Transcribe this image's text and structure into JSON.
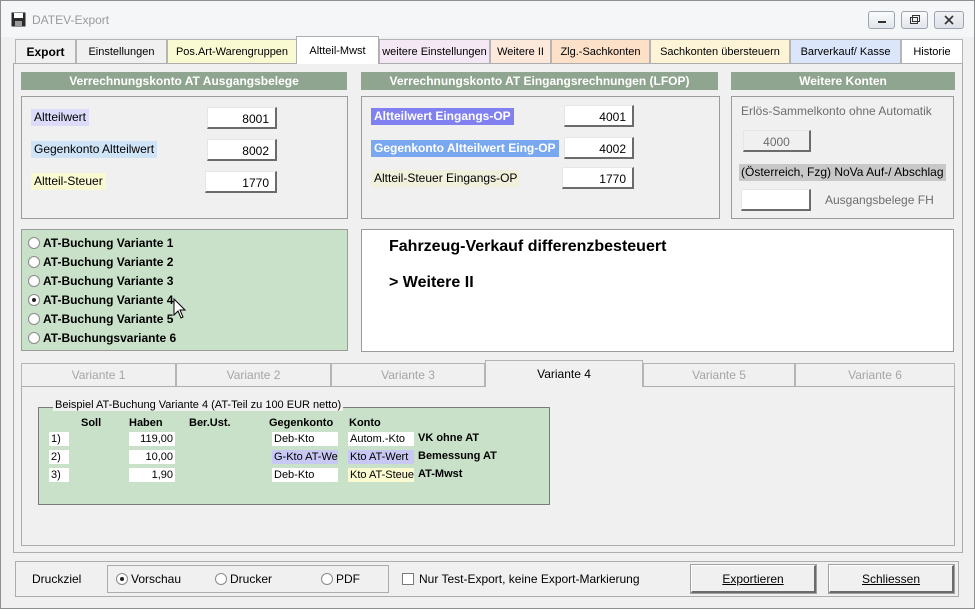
{
  "window": {
    "title": "DATEV-Export"
  },
  "tabs": [
    {
      "label": "Export"
    },
    {
      "label": "Einstellungen"
    },
    {
      "label": "Pos.Art-Warengruppen"
    },
    {
      "label": "Altteil-Mwst"
    },
    {
      "label": "weitere Einstellungen"
    },
    {
      "label": "Weitere II"
    },
    {
      "label": "Zlg.-Sachkonten"
    },
    {
      "label": "Sachkonten übersteuern"
    },
    {
      "label": "Barverkauf/ Kasse"
    },
    {
      "label": "Historie"
    }
  ],
  "tab_colors": {
    "Weitere II": "#fde8dc",
    "Zlg.-Sachkonten": "#fde0c8",
    "Sachkonten übersteuern": "#fdf4d8",
    "Barverkauf/ Kasse": "#dce6fa"
  },
  "ausgang": {
    "title": "Verrechnungskonto AT Ausgangsbelege",
    "rows": [
      {
        "label": "Altteilwert",
        "value": "8001"
      },
      {
        "label": "Gegenkonto Altteilwert",
        "value": "8002"
      },
      {
        "label": "Altteil-Steuer",
        "value": "1770"
      }
    ]
  },
  "eingang": {
    "title": "Verrechnungskonto AT Eingangsrechnungen (LFOP)",
    "rows": [
      {
        "label": "Altteilwert Eingangs-OP",
        "value": "4001"
      },
      {
        "label": "Gegenkonto Altteilwert Eing-OP",
        "value": "4002"
      },
      {
        "label": "Altteil-Steuer Eingangs-OP",
        "value": "1770"
      }
    ]
  },
  "weitere": {
    "title": "Weitere Konten",
    "erloes_label": "Erlös-Sammelkonto ohne Automatik",
    "erloes_value": "4000",
    "nova_label": "(Österreich, Fzg) NoVa Auf-/ Abschlag",
    "ausgang_fh_label": "Ausgangsbelege FH",
    "ausgang_fh_value": ""
  },
  "varianten": {
    "options": [
      "AT-Buchung Variante 1",
      "AT-Buchung Variante 2",
      "AT-Buchung Variante 3",
      "AT-Buchung Variante 4",
      "AT-Buchung Variante 5",
      "AT-Buchungsvariante 6"
    ],
    "selected_index": 3
  },
  "info": {
    "line1": "Fahrzeug-Verkauf differenzbesteuert",
    "line2": "> Weitere II"
  },
  "variant_tabs": [
    "Variante 1",
    "Variante 2",
    "Variante 3",
    "Variante 4",
    "Variante 5",
    "Variante 6"
  ],
  "example": {
    "title": "Beispiel AT-Buchung Variante 4 (AT-Teil zu 100 EUR netto)",
    "headers": {
      "soll": "Soll",
      "haben": "Haben",
      "berust": "Ber.Ust.",
      "gegenkonto": "Gegenkonto",
      "konto": "Konto"
    },
    "rows": [
      {
        "nr": "1)",
        "soll": "",
        "haben": "119,00",
        "berust": "",
        "gegenkonto": "Deb-Kto",
        "konto": "Autom.-Kto",
        "desc": "VK ohne AT"
      },
      {
        "nr": "2)",
        "soll": "",
        "haben": "10,00",
        "berust": "",
        "gegenkonto": "G-Kto AT-Wert",
        "konto": "Kto AT-Wert",
        "desc": "Bemessung AT"
      },
      {
        "nr": "3)",
        "soll": "",
        "haben": "1,90",
        "berust": "",
        "gegenkonto": "Deb-Kto",
        "konto": "Kto AT-Steuer",
        "desc": "AT-Mwst"
      }
    ]
  },
  "bottom": {
    "druckziel_label": "Druckziel",
    "options": [
      "Vorschau",
      "Drucker",
      "PDF"
    ],
    "selected_index": 0,
    "test_export_label": "Nur Test-Export, keine Export-Markierung",
    "test_export_checked": false,
    "export_button": "Exportieren",
    "close_button": "Schliessen"
  },
  "colors": {
    "band_green": "#8fa58f",
    "group_green": "#c9e0c9",
    "altteilwert_bg": "#dcdcfa",
    "gegenkonto_bg": "#d0e4f8",
    "steuer_bg": "#fafad2",
    "eingang_altteilwert_bg": "#8080f0",
    "eingang_gegenkonto_bg": "#7aa8f0",
    "eingang_steuer_bg": "#f0f0dc",
    "nova_bg": "#c8c8c8"
  }
}
